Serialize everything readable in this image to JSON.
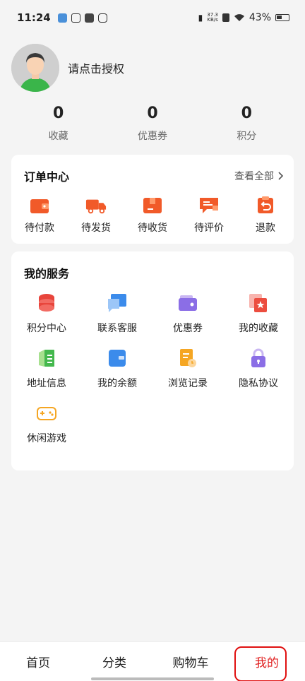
{
  "status_bar": {
    "time": "11:24",
    "speed_value": "37.3",
    "speed_unit": "KB/s",
    "battery": "43%"
  },
  "profile": {
    "auth_prompt": "请点击授权"
  },
  "stats": [
    {
      "value": "0",
      "label": "收藏"
    },
    {
      "value": "0",
      "label": "优惠券"
    },
    {
      "value": "0",
      "label": "积分"
    }
  ],
  "orders": {
    "title": "订单中心",
    "view_all": "查看全部",
    "items": [
      {
        "label": "待付款",
        "icon": "wallet-icon"
      },
      {
        "label": "待发货",
        "icon": "truck-icon"
      },
      {
        "label": "待收货",
        "icon": "package-icon"
      },
      {
        "label": "待评价",
        "icon": "review-icon"
      },
      {
        "label": "退款",
        "icon": "refund-icon"
      }
    ]
  },
  "services": {
    "title": "我的服务",
    "items": [
      {
        "label": "积分中心",
        "icon": "coins-icon"
      },
      {
        "label": "联系客服",
        "icon": "chat-icon"
      },
      {
        "label": "优惠券",
        "icon": "coupon-wallet-icon"
      },
      {
        "label": "我的收藏",
        "icon": "favorite-icon"
      },
      {
        "label": "地址信息",
        "icon": "address-icon"
      },
      {
        "label": "我的余额",
        "icon": "balance-icon"
      },
      {
        "label": "浏览记录",
        "icon": "history-icon"
      },
      {
        "label": "隐私协议",
        "icon": "lock-icon"
      },
      {
        "label": "休闲游戏",
        "icon": "gamepad-icon"
      }
    ]
  },
  "tabbar": {
    "items": [
      "首页",
      "分类",
      "购物车",
      "我的"
    ],
    "active": "我的"
  },
  "colors": {
    "accent": "#f15a29",
    "active_tab": "#e02020"
  }
}
